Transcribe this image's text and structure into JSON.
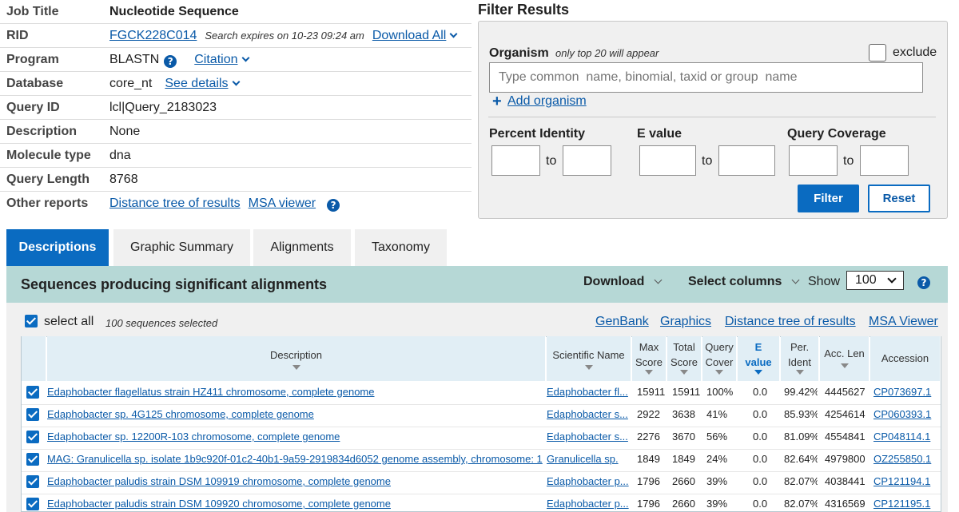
{
  "summary": {
    "job_title": {
      "label": "Job Title",
      "value": "Nucleotide Sequence"
    },
    "rid": {
      "label": "RID",
      "value": "FGCK228C014",
      "expires": "Search expires on 10-23 09:24 am",
      "download": "Download All"
    },
    "program": {
      "label": "Program",
      "value": "BLASTN",
      "citation": "Citation"
    },
    "database": {
      "label": "Database",
      "value": "core_nt",
      "details": "See details"
    },
    "query_id": {
      "label": "Query ID",
      "value": "lcl|Query_2183023"
    },
    "description": {
      "label": "Description",
      "value": "None"
    },
    "molecule_type": {
      "label": "Molecule type",
      "value": "dna"
    },
    "query_length": {
      "label": "Query Length",
      "value": "8768"
    },
    "other_reports": {
      "label": "Other reports",
      "distance_tree": "Distance tree of results",
      "msa_viewer": "MSA viewer"
    }
  },
  "filter": {
    "title": "Filter Results",
    "organism_label": "Organism",
    "organism_note": "only top 20 will appear",
    "exclude_label": "exclude",
    "organism_placeholder": "Type common  name, binomial, taxid or group  name",
    "add_organism": "Add organism",
    "percent_identity_label": "Percent Identity",
    "evalue_label": "E value",
    "query_coverage_label": "Query Coverage",
    "to_label": "to",
    "filter_button": "Filter",
    "reset_button": "Reset"
  },
  "tabs": [
    "Descriptions",
    "Graphic Summary",
    "Alignments",
    "Taxonomy"
  ],
  "results": {
    "title": "Sequences producing significant alignments",
    "download": "Download",
    "select_columns": "Select columns",
    "show_label": "Show",
    "show_value": "100",
    "select_all": "select all",
    "selected_count": "100 sequences selected",
    "links": [
      "GenBank",
      "Graphics",
      "Distance tree of results",
      "MSA Viewer"
    ],
    "columns": {
      "description": "Description",
      "scientific_name": "Scientific Name",
      "max_score": [
        "Max",
        "Score"
      ],
      "total_score": [
        "Total",
        "Score"
      ],
      "query_cover": [
        "Query",
        "Cover"
      ],
      "evalue": [
        "E",
        "value"
      ],
      "per_ident": [
        "Per.",
        "Ident"
      ],
      "acc_len": "Acc. Len",
      "accession": "Accession"
    },
    "rows": [
      {
        "description": "Edaphobacter flagellatus strain HZ411 chromosome, complete genome",
        "sci_name": "Edaphobacter fl...",
        "max_score": "15911",
        "total_score": "15911",
        "query_cover": "100%",
        "evalue": "0.0",
        "per_ident": "99.42%",
        "acc_len": "4445627",
        "accession": "CP073697.1"
      },
      {
        "description": "Edaphobacter sp. 4G125 chromosome, complete genome",
        "sci_name": "Edaphobacter s...",
        "max_score": "2922",
        "total_score": "3638",
        "query_cover": "41%",
        "evalue": "0.0",
        "per_ident": "85.93%",
        "acc_len": "4254614",
        "accession": "CP060393.1"
      },
      {
        "description": "Edaphobacter sp. 12200R-103 chromosome, complete genome",
        "sci_name": "Edaphobacter s...",
        "max_score": "2276",
        "total_score": "3670",
        "query_cover": "56%",
        "evalue": "0.0",
        "per_ident": "81.09%",
        "acc_len": "4554841",
        "accession": "CP048114.1"
      },
      {
        "description": "MAG: Granulicella sp. isolate 1b9c920f-01c2-40b1-9a59-2919834d6052 genome assembly, chromosome: 1",
        "sci_name": "Granulicella sp.",
        "max_score": "1849",
        "total_score": "1849",
        "query_cover": "24%",
        "evalue": "0.0",
        "per_ident": "82.64%",
        "acc_len": "4979800",
        "accession": "OZ255850.1"
      },
      {
        "description": "Edaphobacter paludis strain DSM 109919 chromosome, complete genome",
        "sci_name": "Edaphobacter p...",
        "max_score": "1796",
        "total_score": "2660",
        "query_cover": "39%",
        "evalue": "0.0",
        "per_ident": "82.07%",
        "acc_len": "4038441",
        "accession": "CP121194.1"
      },
      {
        "description": "Edaphobacter paludis strain DSM 109920 chromosome, complete genome",
        "sci_name": "Edaphobacter p...",
        "max_score": "1796",
        "total_score": "2660",
        "query_cover": "39%",
        "evalue": "0.0",
        "per_ident": "82.07%",
        "acc_len": "4316569",
        "accession": "CP121195.1"
      }
    ]
  },
  "colors": {
    "accent": "#0a6bc1",
    "link": "#0a5aa8",
    "header_band": "#b6d8d6",
    "table_header": "#e1eef5"
  }
}
